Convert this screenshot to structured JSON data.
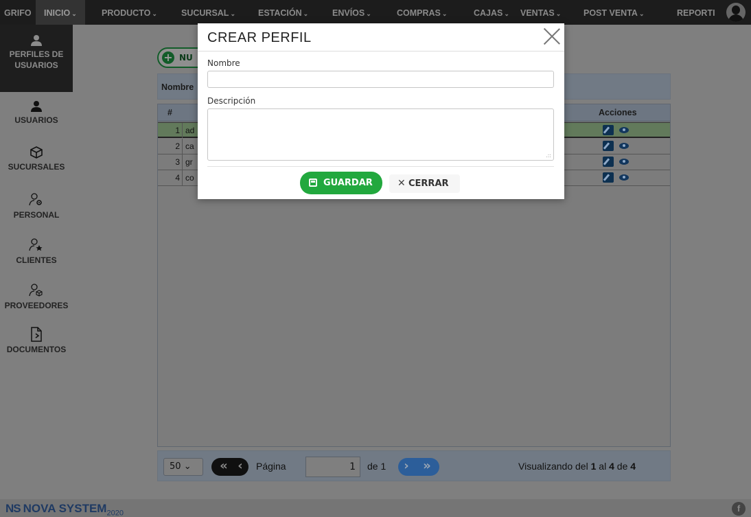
{
  "nav": {
    "items": [
      {
        "label": "GRIFO",
        "chevron": false
      },
      {
        "label": "INICIO",
        "chevron": true,
        "active": true
      },
      {
        "label": "PRODUCTO",
        "chevron": true
      },
      {
        "label": "SUCURSAL",
        "chevron": true
      },
      {
        "label": "ESTACIÓN",
        "chevron": true
      },
      {
        "label": "ENVÍOS",
        "chevron": true
      },
      {
        "label": "COMPRAS",
        "chevron": true
      },
      {
        "label": "CAJAS",
        "chevron": true
      },
      {
        "label": "VENTAS",
        "chevron": true
      },
      {
        "label": "POST VENTA",
        "chevron": true
      },
      {
        "label": "REPORTI",
        "chevron": false
      }
    ],
    "chevron_glyph": "⌄"
  },
  "sidebar": {
    "items": [
      {
        "label1": "PERFILES DE",
        "label2": "USUARIOS",
        "icon": "user-icon",
        "active": true
      },
      {
        "label1": "USUARIOS",
        "icon": "user-icon"
      },
      {
        "label1": "SUCURSALES",
        "icon": "box-icon"
      },
      {
        "label1": "PERSONAL",
        "icon": "user-gear-icon"
      },
      {
        "label1": "CLIENTES",
        "icon": "user-star-icon"
      },
      {
        "label1": "PROVEEDORES",
        "icon": "user-box-icon"
      },
      {
        "label1": "DOCUMENTOS",
        "icon": "document-icon"
      }
    ]
  },
  "toolbar": {
    "new_label": "NU"
  },
  "filter": {
    "label": "Nombre"
  },
  "grid": {
    "columns": {
      "num": "#",
      "actions": "Acciones"
    },
    "rows": [
      {
        "num": "1",
        "name": "ad",
        "selected": true
      },
      {
        "num": "2",
        "name": "ca"
      },
      {
        "num": "3",
        "name": "gr"
      },
      {
        "num": "4",
        "name": "co"
      }
    ]
  },
  "pager": {
    "page_size": "50",
    "page_label": "Página",
    "page_value": "1",
    "of_label": "de 1",
    "showing_prefix": "Visualizando del",
    "showing_from": "1",
    "showing_mid": "al",
    "showing_to": "4",
    "showing_of": "de",
    "showing_total": "4"
  },
  "footer": {
    "brand_mark": "NS",
    "brand_name": "NOVA SYSTEM",
    "brand_year": "2020",
    "fb_icon": "f"
  },
  "modal": {
    "title": "CREAR PERFIL",
    "name_label": "Nombre",
    "name_value": "",
    "desc_label": "Descripción",
    "desc_value": "",
    "save_label": "GUARDAR",
    "cancel_label": "CERRAR",
    "colors": {
      "save": "#22a83e"
    }
  }
}
